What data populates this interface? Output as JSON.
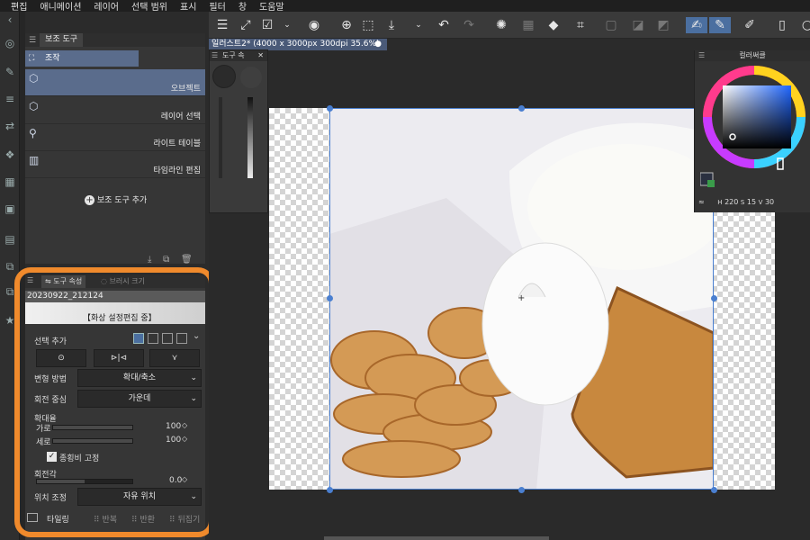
{
  "menu": [
    "편집",
    "애니메이션",
    "레이어",
    "선택 범위",
    "표시",
    "필터",
    "창",
    "도움말"
  ],
  "document_tab": {
    "title": "일러스트2* (4000 x 3000px 300dpi 35.6%)"
  },
  "subtool_panel": {
    "tab": "보조 도구",
    "group": "조작",
    "items": [
      {
        "label": "오브젝트",
        "selected": true
      },
      {
        "label": "레이어 선택",
        "selected": false
      },
      {
        "label": "라이트 테이블",
        "selected": false
      },
      {
        "label": "타임라인 편집",
        "selected": false
      }
    ],
    "add_label": "보조 도구 추가"
  },
  "brush_panel": {
    "title": "도구 속"
  },
  "tool_property": {
    "tab_active": "도구 속성",
    "tab_inactive": "브러시 크기",
    "preset_name": "20230922_212124",
    "edit_label": "【화상 설정편집 중】",
    "selection_label": "선택 추가",
    "transform_method_label": "변형 방법",
    "transform_method_value": "확대/축소",
    "rotation_center_label": "회전 중심",
    "rotation_center_value": "가운데",
    "scale_label": "확대율",
    "width_label": "가로",
    "width_value": "100",
    "height_label": "세로",
    "height_value": "100",
    "keep_ratio_label": "종횡비 고정",
    "keep_ratio_checked": true,
    "rotation_angle_label": "회전각",
    "rotation_angle_value": "0.0",
    "position_label": "위치 조정",
    "position_value": "자유 위치",
    "tiling_label": "타일링",
    "repeat_label": "반복",
    "flip_label": "반환",
    "wrap_label": "뒤집기"
  },
  "color_panel": {
    "title": "컬러써클",
    "value_h": "220",
    "value_s": "15",
    "value_v": "30",
    "h_tag": "H",
    "s_tag": "S",
    "v_tag": "V"
  },
  "colors": {
    "accent": "#4b6fa0",
    "highlight": "#f08a2c",
    "selected_color": "#2a3040"
  }
}
